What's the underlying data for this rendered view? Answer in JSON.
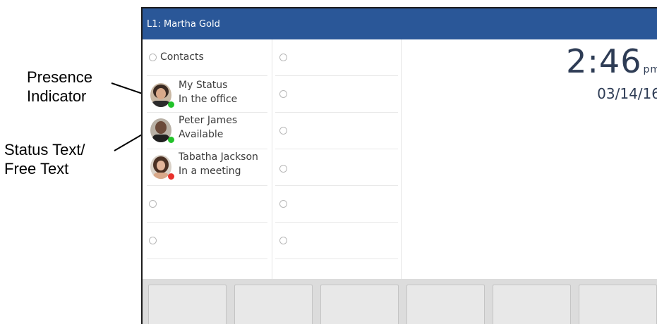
{
  "callouts": {
    "presence": [
      "Presence",
      "Indicator"
    ],
    "status": [
      "Status Text/",
      "Free Text"
    ]
  },
  "screen": {
    "title": "L1: Martha Gold",
    "clock": {
      "time": "2:46",
      "ampm": "pm",
      "date": "03/14/16"
    },
    "contacts_label": "Contacts",
    "line_keys": [
      {
        "name": "My Status",
        "status": "In the office",
        "presence": "available",
        "presence_color": "#22c22a"
      },
      {
        "name": "Peter James",
        "status": "Available",
        "presence": "available",
        "presence_color": "#22c22a"
      },
      {
        "name": "Tabatha Jackson",
        "status": "In a meeting",
        "presence": "busy",
        "presence_color": "#e8312c"
      }
    ]
  },
  "colors": {
    "title_bar": "#2a5798",
    "softkey_bar": "#dcdcdc",
    "clock_text": "#2e3c55"
  }
}
